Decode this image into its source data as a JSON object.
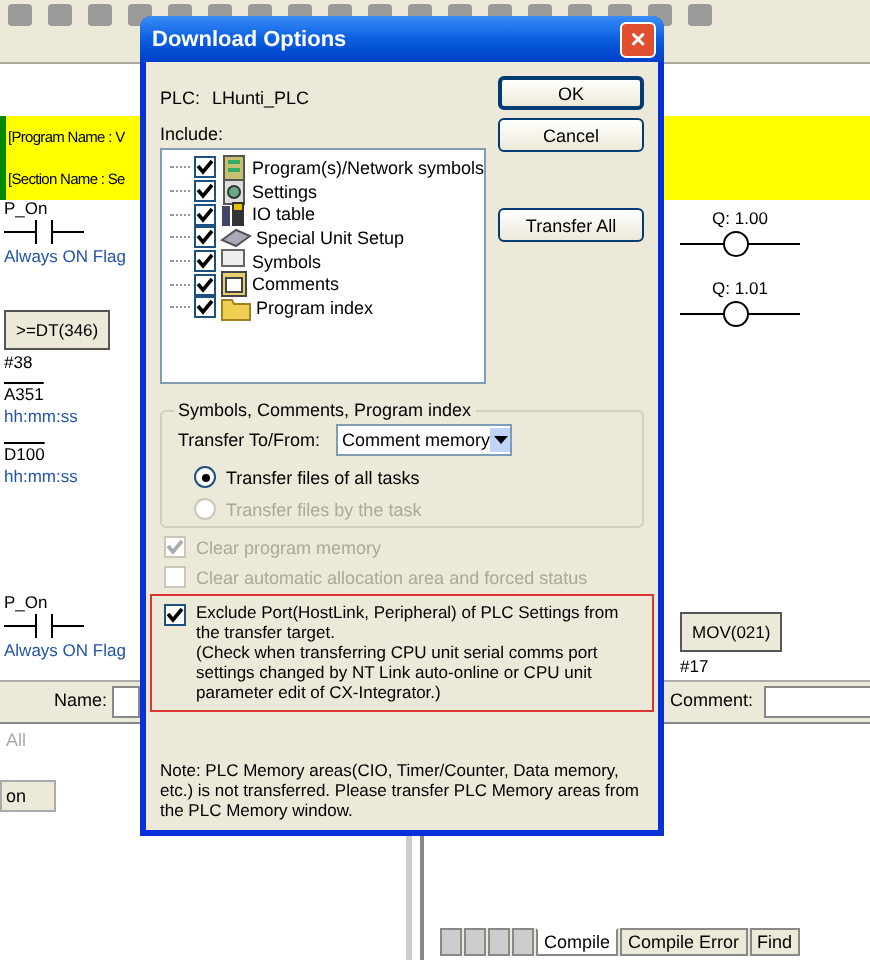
{
  "editor": {
    "header_lines": [
      "[Program Name : V",
      "[Section Name : Se"
    ],
    "ladder_left": [
      {
        "kind": "contact",
        "label": "P_On",
        "comment": "Always ON Flag"
      },
      {
        "kind": "block",
        "label": ">=DT(346)"
      },
      {
        "kind": "text",
        "label": "#38"
      },
      {
        "kind": "operand",
        "label": "A351",
        "comment": "hh:mm:ss"
      },
      {
        "kind": "operand",
        "label": "D100",
        "comment": "hh:mm:ss"
      },
      {
        "kind": "contact",
        "label": "P_On",
        "comment": "Always ON Flag"
      }
    ],
    "ladder_right": [
      {
        "kind": "coil",
        "label": "Q: 1.00"
      },
      {
        "kind": "coil",
        "label": "Q: 1.01"
      },
      {
        "kind": "block",
        "label": "MOV(021)"
      },
      {
        "kind": "text",
        "label": "#17"
      }
    ],
    "name_label": "Name:",
    "comment_label": "Comment:",
    "all_label": "All",
    "column_1": "on",
    "tabs": [
      {
        "label": "Compile",
        "selected": true
      },
      {
        "label": "Compile Error",
        "selected": false
      },
      {
        "label": "Find",
        "selected": false
      }
    ]
  },
  "dialog": {
    "title": "Download Options",
    "close": "×",
    "plc_label": "PLC:",
    "plc_name": "LHunti_PLC",
    "include_label": "Include:",
    "items": [
      {
        "label": "Program(s)/Network symbols",
        "kind": "program",
        "checked": true
      },
      {
        "label": "Settings",
        "kind": "settings",
        "checked": true
      },
      {
        "label": "IO table",
        "kind": "io",
        "checked": true
      },
      {
        "label": "Special Unit Setup",
        "kind": "unit",
        "checked": true
      },
      {
        "label": "Symbols",
        "kind": "symbols",
        "checked": true
      },
      {
        "label": "Comments",
        "kind": "comments",
        "checked": true
      },
      {
        "label": "Program index",
        "kind": "folder",
        "checked": true
      }
    ],
    "buttons": {
      "ok": "OK",
      "cancel": "Cancel",
      "transfer_all": "Transfer All"
    },
    "group_title": "Symbols, Comments, Program index",
    "transfer_label": "Transfer To/From:",
    "transfer_value": "Comment memory",
    "radios": [
      {
        "label": "Transfer files of all tasks",
        "selected": true,
        "disabled": false
      },
      {
        "label": "Transfer files by the task",
        "selected": false,
        "disabled": true
      }
    ],
    "options": [
      {
        "label": "Clear program memory",
        "checked": true,
        "disabled": true
      },
      {
        "label": "Clear automatic allocation area and forced status",
        "checked": false,
        "disabled": true
      }
    ],
    "exclude": {
      "label": "Exclude Port(HostLink, Peripheral) of PLC Settings from the transfer target.",
      "detail": "(Check when transferring CPU unit serial comms port settings changed by NT Link auto-online or CPU unit parameter edit of CX-Integrator.)",
      "checked": true
    },
    "note": "Note: PLC Memory areas(CIO, Timer/Counter, Data memory, etc.) is not transferred. Please transfer PLC Memory areas from the PLC Memory window."
  }
}
